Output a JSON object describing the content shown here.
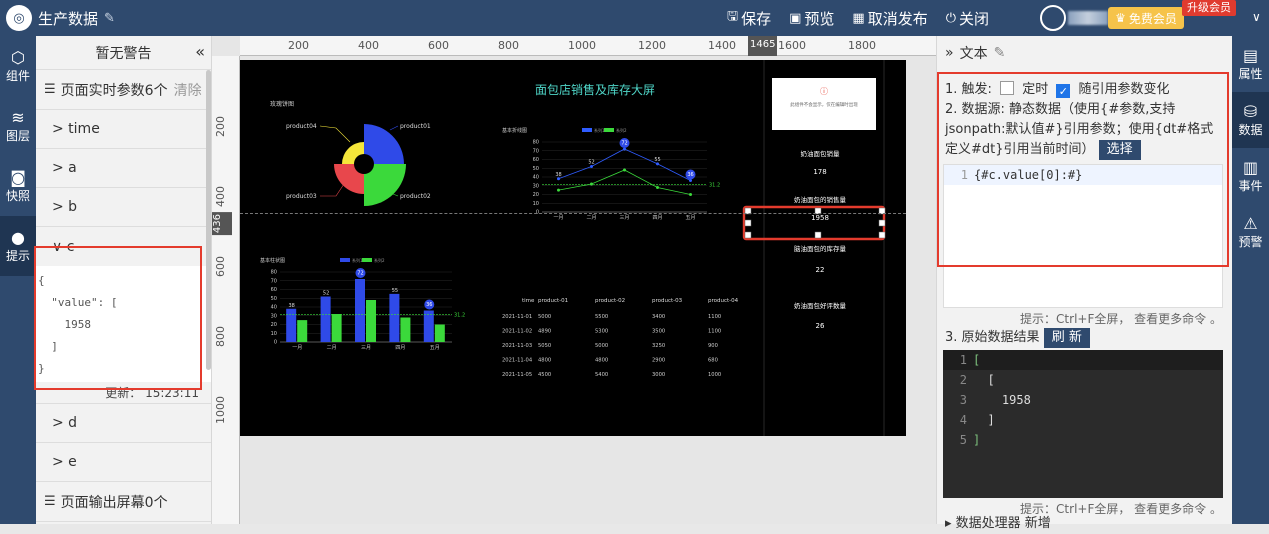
{
  "header": {
    "title": "生产数据",
    "toolbar": [
      {
        "icon": "save-icon",
        "glyph": "🖫",
        "label": "保存"
      },
      {
        "icon": "preview-icon",
        "glyph": "▣",
        "label": "预览"
      },
      {
        "icon": "unpublish-icon",
        "glyph": "▦",
        "label": "取消发布"
      },
      {
        "icon": "power-icon",
        "glyph": "⏻",
        "label": "关闭"
      }
    ],
    "member_label": "免费会员",
    "upgrade_label": "升级会员"
  },
  "left_rail": [
    {
      "label": "组件",
      "glyph": "⬡"
    },
    {
      "label": "图层",
      "glyph": "≋"
    },
    {
      "label": "快照",
      "glyph": "◙"
    },
    {
      "label": "提示",
      "glyph": "●"
    }
  ],
  "left_panel": {
    "header": "暂无警告",
    "realtime_section": "页面实时参数6个",
    "clear_label": "清除",
    "params_top": [
      "> time",
      "> a",
      "> b"
    ],
    "expanded_param": "∨ c",
    "expanded_json": "{\n  \"value\": [\n    1958\n  ]\n}",
    "update_label": "更新： 15:23:11",
    "params_bottom": [
      "> d",
      "> e"
    ],
    "output_section": "页面输出屏幕0个"
  },
  "rulers": {
    "top_labels": [
      "200",
      "400",
      "600",
      "800",
      "1000",
      "1200",
      "1400",
      "1600",
      "1800"
    ],
    "top_marker": "1465",
    "left_labels": [
      "200",
      "400",
      "600",
      "800",
      "1000"
    ],
    "left_marker": "436"
  },
  "stage": {
    "main_title": "面包店销售及库存大屏",
    "pie_title": "玫瑰饼图",
    "pie_labels": [
      "product04",
      "product01",
      "product03",
      "product02"
    ],
    "line_title": "基本折线图",
    "line_legend": [
      "系列1",
      "系列2"
    ],
    "bar_title": "基本柱状图",
    "bar_legend": [
      "系列1",
      "系列2"
    ],
    "notice_text": "此组件不会显示，仅在编辑时出现",
    "kpis": [
      {
        "label": "奶油面包销量",
        "value": "178"
      },
      {
        "label": "奶油面包的销售量",
        "value": "1958"
      },
      {
        "label": "脑油面包的库存量",
        "value": "22"
      },
      {
        "label": "奶油面包好评数量",
        "value": "26"
      }
    ],
    "table": {
      "headers": [
        "time",
        "product-01",
        "product-02",
        "product-03",
        "product-04"
      ],
      "rows": [
        [
          "2021-11-01",
          "5000",
          "5500",
          "3400",
          "1100"
        ],
        [
          "2021-11-02",
          "4890",
          "5300",
          "3500",
          "1100"
        ],
        [
          "2021-11-03",
          "5050",
          "5000",
          "3250",
          "900"
        ],
        [
          "2021-11-04",
          "4800",
          "4800",
          "2900",
          "680"
        ],
        [
          "2021-11-05",
          "4500",
          "5400",
          "3000",
          "1000"
        ]
      ]
    }
  },
  "chart_data": [
    {
      "type": "line",
      "title": "基本折线图",
      "categories": [
        "一月",
        "二月",
        "三月",
        "四月",
        "五月"
      ],
      "ylim": [
        0,
        80
      ],
      "yticks": [
        0,
        10,
        20,
        30,
        40,
        50,
        60,
        70,
        80
      ],
      "series": [
        {
          "name": "系列1",
          "color": "#2f5cff",
          "values": [
            38,
            52,
            72,
            55,
            36
          ]
        },
        {
          "name": "系列2",
          "color": "#3bd93b",
          "values": [
            25,
            32,
            48,
            28,
            20
          ]
        }
      ],
      "markline": "31.2"
    },
    {
      "type": "bar",
      "title": "基本柱状图",
      "categories": [
        "一月",
        "二月",
        "三月",
        "四月",
        "五月"
      ],
      "ylim": [
        0,
        80
      ],
      "yticks": [
        0,
        10,
        20,
        30,
        40,
        50,
        60,
        70,
        80
      ],
      "series": [
        {
          "name": "系列1",
          "color": "#2f4ae8",
          "values": [
            38,
            52,
            72,
            55,
            36
          ]
        },
        {
          "name": "系列2",
          "color": "#3bd93b",
          "values": [
            25,
            32,
            48,
            28,
            20
          ]
        }
      ],
      "markline": "31.2"
    },
    {
      "type": "pie",
      "title": "玫瑰饼图",
      "labels": [
        "product01",
        "product02",
        "product03",
        "product04"
      ],
      "colors": [
        "#2f4ae8",
        "#3bd93b",
        "#e8474c",
        "#f5e63a"
      ]
    }
  ],
  "right_panel": {
    "title": "文本",
    "trigger_label": "1. 触发:",
    "timer_label": "定时",
    "follow_label": "随引用参数变化",
    "source_text": "2. 数据源:  静态数据（使用{#参数,支持jsonpath:默认值#}引用参数；使用{dt#格式定义#dt}引用当前时间）",
    "select_label": "选择",
    "code_line": "{#c.value[0]:#}",
    "hint": "提示：Ctrl+F全屏， 查看更多命令 。",
    "result_label": "3. 原始数据结果",
    "refresh_label": "刷 新",
    "result_lines": [
      "[",
      "  [",
      "    1958",
      "  ]",
      "]"
    ],
    "bottom_label": "▸ 数据处理器  新增"
  },
  "right_rail": [
    {
      "label": "属性",
      "glyph": "▤"
    },
    {
      "label": "数据",
      "glyph": "⛁"
    },
    {
      "label": "事件",
      "glyph": "▥"
    },
    {
      "label": "预警",
      "glyph": "⚠"
    }
  ]
}
